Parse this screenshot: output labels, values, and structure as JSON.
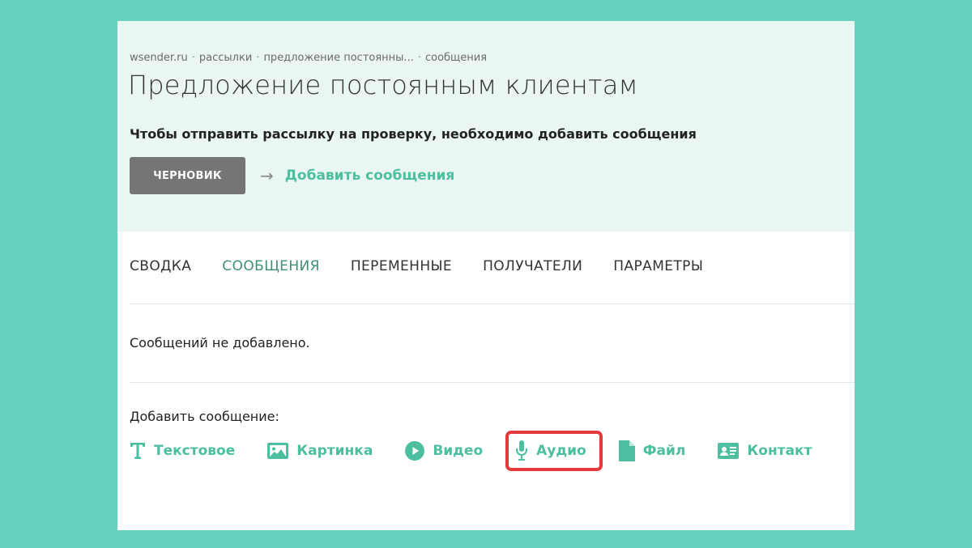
{
  "breadcrumb": [
    "wsender.ru",
    "рассылки",
    "предложение постоянны...",
    "сообщения"
  ],
  "page_title": "Предложение постоянным клиентам",
  "notice": "Чтобы отправить рассылку на проверку, необходимо добавить сообщения",
  "status": {
    "badge": "ЧЕРНОВИК",
    "arrow": "→",
    "add_messages_link": "Добавить сообщения"
  },
  "tabs": [
    {
      "label": "СВОДКА",
      "active": false
    },
    {
      "label": "СООБЩЕНИЯ",
      "active": true
    },
    {
      "label": "ПЕРЕМЕННЫЕ",
      "active": false
    },
    {
      "label": "ПОЛУЧАТЕЛИ",
      "active": false
    },
    {
      "label": "ПАРАМЕТРЫ",
      "active": false
    }
  ],
  "empty_message": "Сообщений не добавлено.",
  "add_message_label": "Добавить сообщение:",
  "message_types": [
    {
      "label": "Текстовое",
      "icon": "text-t-icon"
    },
    {
      "label": "Картинка",
      "icon": "image-icon"
    },
    {
      "label": "Видео",
      "icon": "play-circle-icon"
    },
    {
      "label": "Аудио",
      "icon": "microphone-icon",
      "highlighted": true
    },
    {
      "label": "Файл",
      "icon": "file-icon"
    },
    {
      "label": "Контакт",
      "icon": "contact-card-icon"
    }
  ],
  "colors": {
    "background": "#66d1bf",
    "header_bg": "#eaf6f2",
    "accent": "#4cbfa0",
    "active_tab": "#3f8f78",
    "badge_bg": "#757575",
    "highlight_border": "#e5383b"
  }
}
